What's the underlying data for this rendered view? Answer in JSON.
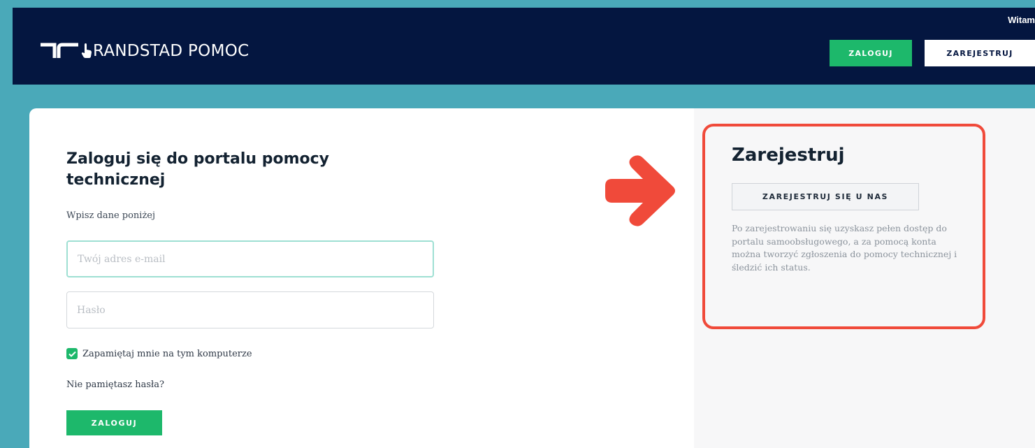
{
  "header": {
    "brand": "RANDSTAD POMOC",
    "greeting": "Witam",
    "login_button": "ZALOGUJ",
    "register_button": "ZAREJESTRUJ"
  },
  "login": {
    "title": "Zaloguj się do portalu pomocy technicznej",
    "subtitle": "Wpisz dane poniżej",
    "email_placeholder": "Twój adres e-mail",
    "password_placeholder": "Hasło",
    "remember_label": "Zapamiętaj mnie na tym komputerze",
    "remember_checked": true,
    "forgot_link": "Nie pamiętasz hasła?",
    "submit_button": "ZALOGUJ"
  },
  "register": {
    "title": "Zarejestruj",
    "button": "ZAREJESTRUJ SIĘ U NAS",
    "description": "Po zarejestrowaniu się uzyskasz pełen dostęp do portalu samoobsługowego, a za pomocą konta można tworzyć zgłoszenia do pomocy technicznej i śledzić ich status."
  },
  "icons": {
    "logo": "randstad-logo-icon",
    "hand": "hand-pointer-icon",
    "check": "checkmark-icon",
    "arrow": "right-arrow-icon"
  },
  "colors": {
    "page_background": "#4aa9b9",
    "header_background": "#041640",
    "accent_green": "#1db86b",
    "highlight_red": "#f04a3a"
  }
}
